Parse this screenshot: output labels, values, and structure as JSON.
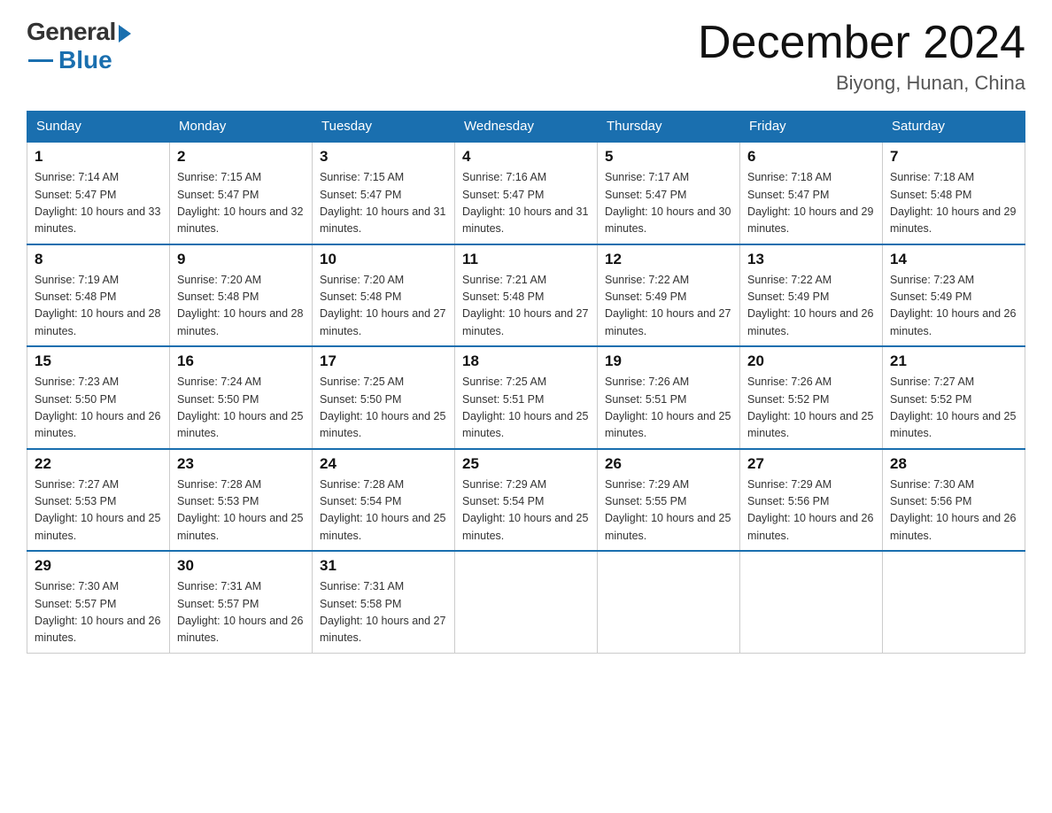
{
  "header": {
    "logo_general": "General",
    "logo_blue": "Blue",
    "month_title": "December 2024",
    "location": "Biyong, Hunan, China"
  },
  "days_of_week": [
    "Sunday",
    "Monday",
    "Tuesday",
    "Wednesday",
    "Thursday",
    "Friday",
    "Saturday"
  ],
  "weeks": [
    [
      {
        "day": "1",
        "sunrise": "7:14 AM",
        "sunset": "5:47 PM",
        "daylight": "10 hours and 33 minutes."
      },
      {
        "day": "2",
        "sunrise": "7:15 AM",
        "sunset": "5:47 PM",
        "daylight": "10 hours and 32 minutes."
      },
      {
        "day": "3",
        "sunrise": "7:15 AM",
        "sunset": "5:47 PM",
        "daylight": "10 hours and 31 minutes."
      },
      {
        "day": "4",
        "sunrise": "7:16 AM",
        "sunset": "5:47 PM",
        "daylight": "10 hours and 31 minutes."
      },
      {
        "day": "5",
        "sunrise": "7:17 AM",
        "sunset": "5:47 PM",
        "daylight": "10 hours and 30 minutes."
      },
      {
        "day": "6",
        "sunrise": "7:18 AM",
        "sunset": "5:47 PM",
        "daylight": "10 hours and 29 minutes."
      },
      {
        "day": "7",
        "sunrise": "7:18 AM",
        "sunset": "5:48 PM",
        "daylight": "10 hours and 29 minutes."
      }
    ],
    [
      {
        "day": "8",
        "sunrise": "7:19 AM",
        "sunset": "5:48 PM",
        "daylight": "10 hours and 28 minutes."
      },
      {
        "day": "9",
        "sunrise": "7:20 AM",
        "sunset": "5:48 PM",
        "daylight": "10 hours and 28 minutes."
      },
      {
        "day": "10",
        "sunrise": "7:20 AM",
        "sunset": "5:48 PM",
        "daylight": "10 hours and 27 minutes."
      },
      {
        "day": "11",
        "sunrise": "7:21 AM",
        "sunset": "5:48 PM",
        "daylight": "10 hours and 27 minutes."
      },
      {
        "day": "12",
        "sunrise": "7:22 AM",
        "sunset": "5:49 PM",
        "daylight": "10 hours and 27 minutes."
      },
      {
        "day": "13",
        "sunrise": "7:22 AM",
        "sunset": "5:49 PM",
        "daylight": "10 hours and 26 minutes."
      },
      {
        "day": "14",
        "sunrise": "7:23 AM",
        "sunset": "5:49 PM",
        "daylight": "10 hours and 26 minutes."
      }
    ],
    [
      {
        "day": "15",
        "sunrise": "7:23 AM",
        "sunset": "5:50 PM",
        "daylight": "10 hours and 26 minutes."
      },
      {
        "day": "16",
        "sunrise": "7:24 AM",
        "sunset": "5:50 PM",
        "daylight": "10 hours and 25 minutes."
      },
      {
        "day": "17",
        "sunrise": "7:25 AM",
        "sunset": "5:50 PM",
        "daylight": "10 hours and 25 minutes."
      },
      {
        "day": "18",
        "sunrise": "7:25 AM",
        "sunset": "5:51 PM",
        "daylight": "10 hours and 25 minutes."
      },
      {
        "day": "19",
        "sunrise": "7:26 AM",
        "sunset": "5:51 PM",
        "daylight": "10 hours and 25 minutes."
      },
      {
        "day": "20",
        "sunrise": "7:26 AM",
        "sunset": "5:52 PM",
        "daylight": "10 hours and 25 minutes."
      },
      {
        "day": "21",
        "sunrise": "7:27 AM",
        "sunset": "5:52 PM",
        "daylight": "10 hours and 25 minutes."
      }
    ],
    [
      {
        "day": "22",
        "sunrise": "7:27 AM",
        "sunset": "5:53 PM",
        "daylight": "10 hours and 25 minutes."
      },
      {
        "day": "23",
        "sunrise": "7:28 AM",
        "sunset": "5:53 PM",
        "daylight": "10 hours and 25 minutes."
      },
      {
        "day": "24",
        "sunrise": "7:28 AM",
        "sunset": "5:54 PM",
        "daylight": "10 hours and 25 minutes."
      },
      {
        "day": "25",
        "sunrise": "7:29 AM",
        "sunset": "5:54 PM",
        "daylight": "10 hours and 25 minutes."
      },
      {
        "day": "26",
        "sunrise": "7:29 AM",
        "sunset": "5:55 PM",
        "daylight": "10 hours and 25 minutes."
      },
      {
        "day": "27",
        "sunrise": "7:29 AM",
        "sunset": "5:56 PM",
        "daylight": "10 hours and 26 minutes."
      },
      {
        "day": "28",
        "sunrise": "7:30 AM",
        "sunset": "5:56 PM",
        "daylight": "10 hours and 26 minutes."
      }
    ],
    [
      {
        "day": "29",
        "sunrise": "7:30 AM",
        "sunset": "5:57 PM",
        "daylight": "10 hours and 26 minutes."
      },
      {
        "day": "30",
        "sunrise": "7:31 AM",
        "sunset": "5:57 PM",
        "daylight": "10 hours and 26 minutes."
      },
      {
        "day": "31",
        "sunrise": "7:31 AM",
        "sunset": "5:58 PM",
        "daylight": "10 hours and 27 minutes."
      },
      null,
      null,
      null,
      null
    ]
  ]
}
